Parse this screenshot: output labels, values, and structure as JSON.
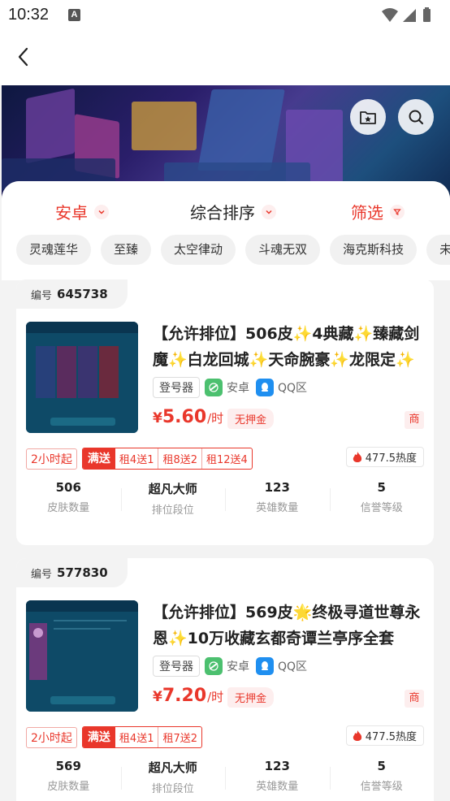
{
  "status_bar": {
    "time": "10:32",
    "notification_icon": "A"
  },
  "nav": {
    "back_icon": "chevron-left"
  },
  "filters": {
    "platform": "安卓",
    "sort": "综合排序",
    "filter": "筛选"
  },
  "tags": [
    "灵魂莲华",
    "至臻",
    "太空律动",
    "斗魂无双",
    "海克斯科技",
    "未来战"
  ],
  "listings": [
    {
      "id_label": "编号",
      "id": "645738",
      "title": "【允许排位】506皮✨4典藏✨臻藏剑魔✨白龙回城✨天命腕豪✨龙限定✨",
      "login_badge": "登号器",
      "platform": "安卓",
      "server": "QQ区",
      "currency": "¥",
      "price": "5.60",
      "price_unit": "/时",
      "deposit": "无押金",
      "merchant": "商",
      "min_rent": "2小时起",
      "promo_label": "满送",
      "promos": [
        "租4送1",
        "租8送2",
        "租12送4"
      ],
      "heat": "477.5热度",
      "stats": [
        {
          "value": "506",
          "label": "皮肤数量"
        },
        {
          "value": "超凡大师",
          "label": "排位段位"
        },
        {
          "value": "123",
          "label": "英雄数量"
        },
        {
          "value": "5",
          "label": "信誉等级"
        }
      ]
    },
    {
      "id_label": "编号",
      "id": "577830",
      "title": "【允许排位】569皮🌟终极寻道世尊永恩✨10万收藏玄都奇谭兰亭序全套",
      "login_badge": "登号器",
      "platform": "安卓",
      "server": "QQ区",
      "currency": "¥",
      "price": "7.20",
      "price_unit": "/时",
      "deposit": "无押金",
      "merchant": "商",
      "min_rent": "2小时起",
      "promo_label": "满送",
      "promos": [
        "租4送1",
        "租7送2"
      ],
      "heat": "477.5热度",
      "stats": [
        {
          "value": "569",
          "label": "皮肤数量"
        },
        {
          "value": "超凡大师",
          "label": "排位段位"
        },
        {
          "value": "123",
          "label": "英雄数量"
        },
        {
          "value": "5",
          "label": "信誉等级"
        }
      ]
    }
  ],
  "colors": {
    "accent": "#e9372b",
    "android_green": "#4cc06f",
    "qq_blue": "#1f8ff0"
  }
}
